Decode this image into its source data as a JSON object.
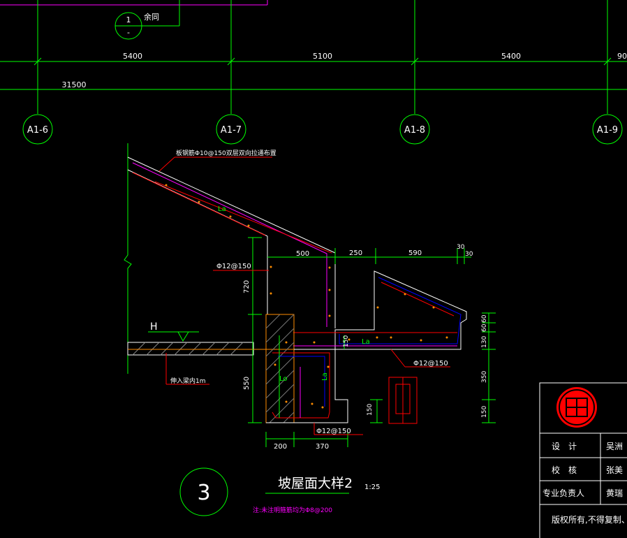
{
  "note_ref": {
    "top": "1",
    "bottom": "-",
    "label": "余同"
  },
  "dimensions_top": {
    "d1": "5400",
    "d2": "5100",
    "d3": "5400",
    "d4": "90",
    "total": "31500"
  },
  "axes": [
    "A1-6",
    "A1-7",
    "A1-8",
    "A1-9"
  ],
  "annotations": {
    "rebar_roof": "板钢筋Φ10@150双层双向拉通布置",
    "la1": "La",
    "phi12_left": "Φ12@150",
    "dim_500": "500",
    "dim_250": "250",
    "dim_590": "590",
    "dim_30a": "30",
    "dim_30b": "30",
    "dim_720": "720",
    "la2": "La",
    "dim_150_mid": "150",
    "la3": "Lo",
    "la4": "La",
    "phi12_right": "Φ12@150",
    "dim_550": "550",
    "dim_150_small": "150",
    "phi12_bottom": "Φ12@150",
    "dim_200": "200",
    "dim_370": "370",
    "dim_60a": "60",
    "dim_60b": "60",
    "dim_130": "130",
    "dim_350": "350",
    "dim_150_right": "150",
    "h_mark": "H",
    "anchor_note": "伸入梁内1m"
  },
  "detail": {
    "number": "3",
    "title": "坡屋面大样2",
    "scale": "1:25",
    "note": "注:未注明箍筋均为Φ8@200"
  },
  "title_block": {
    "rows": [
      {
        "label": "设　计",
        "value": "吴洲"
      },
      {
        "label": "校　核",
        "value": "张美"
      },
      {
        "label": "专业负责人",
        "value": "黄瑞"
      }
    ],
    "footer": "版权所有,不得复制、套用"
  },
  "colors": {
    "green": "#00ff00",
    "red": "#ff0000",
    "magenta": "#ff00ff",
    "white": "#ffffff",
    "orange": "#ff8c00",
    "blue": "#0000ff"
  }
}
